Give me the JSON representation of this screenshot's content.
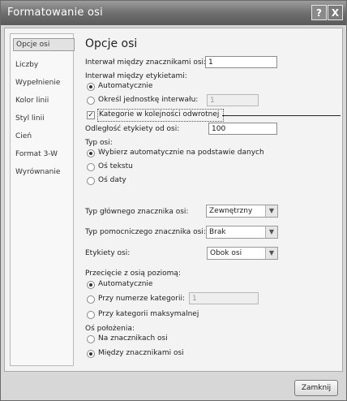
{
  "window": {
    "title": "Formatowanie osi",
    "help_glyph": "?",
    "close_glyph": "X"
  },
  "nav": {
    "items": [
      {
        "label": "Opcje osi",
        "selected": true
      },
      {
        "label": "Liczby"
      },
      {
        "label": "Wypełnienie"
      },
      {
        "label": "Kolor linii"
      },
      {
        "label": "Styl linii"
      },
      {
        "label": "Cień"
      },
      {
        "label": "Format 3-W"
      },
      {
        "label": "Wyrównanie"
      }
    ]
  },
  "main": {
    "heading": "Opcje osi",
    "interval_marks_label": "Interwał między znacznikami osi:",
    "interval_marks_value": "1",
    "interval_labels_label": "Interwał między etykietami:",
    "auto_label": "Automatycznie",
    "specify_interval_label": "Określ jednostkę interwału:",
    "specify_interval_value": "1",
    "reverse_order_label": "Kategorie w kolejności odwrotnej",
    "label_distance_label": "Odległość etykiety od osi:",
    "label_distance_value": "100",
    "axis_type_label": "Typ osi:",
    "axis_type_auto_label": "Wybierz automatycznie na podstawie danych",
    "axis_type_text_label": "Oś tekstu",
    "axis_type_date_label": "Oś daty",
    "major_tick_label": "Typ głównego znacznika osi:",
    "major_tick_value": "Zewnętrzny",
    "minor_tick_label": "Typ pomocniczego znacznika osi:",
    "minor_tick_value": "Brak",
    "axis_labels_label": "Etykiety osi:",
    "axis_labels_value": "Obok osi",
    "crossing_label": "Przecięcie z osią poziomą:",
    "crossing_auto_label": "Automatycznie",
    "crossing_at_label": "Przy numerze kategorii:",
    "crossing_at_value": "1",
    "crossing_max_label": "Przy kategorii maksymalnej",
    "position_label": "Oś położenia:",
    "position_on_ticks_label": "Na znacznikach osi",
    "position_between_label": "Między znacznikami osi"
  },
  "footer": {
    "close_label": "Zamknij"
  }
}
